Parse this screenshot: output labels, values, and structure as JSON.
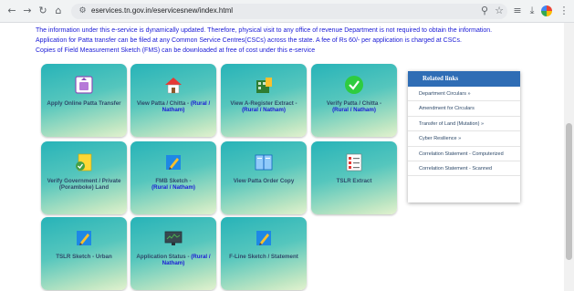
{
  "browser": {
    "url": "eservices.tn.gov.in/eservicesnew/index.html"
  },
  "info_lines": [
    "The information under this e-service is dynamically updated. Therefore, physical visit to any office of revenue Department is not required to obtain the information.",
    "Application for Patta transfer can be filed at any Common Service Centres(CSCs) across the state. A fee of Rs 60/- per application is charged at CSCs.",
    "Copies of Field Measurement Sketch (FMS) can be downloaded at free of cost under this e-service"
  ],
  "tiles": [
    {
      "label": "Apply Online Patta Transfer",
      "sub": "",
      "icon": "document-upload-icon"
    },
    {
      "label": "View Patta / Chitta -",
      "sub": "(Rural / Natham)",
      "icon": "house-icon"
    },
    {
      "label": "View A-Register Extract -",
      "sub": "(Rural / Natham)",
      "icon": "building-document-icon"
    },
    {
      "label": "Verify Patta / Chitta -",
      "sub": "(Rural / Natham)",
      "icon": "checkmark-icon"
    },
    {
      "label": "Verify Government / Private (Poramboke) Land",
      "sub": "",
      "icon": "document-check-icon"
    },
    {
      "label": "FMB Sketch -",
      "sub": "(Rural / Natham)",
      "icon": "pencil-sketch-icon"
    },
    {
      "label": "View Patta Order Copy",
      "sub": "",
      "icon": "book-icon"
    },
    {
      "label": "TSLR Extract",
      "sub": "",
      "icon": "form-list-icon"
    },
    {
      "label": "TSLR Sketch - Urban",
      "sub": "",
      "icon": "pencil-sketch-icon"
    },
    {
      "label": "Application Status -",
      "sub": "(Rural / Natham)",
      "icon": "monitor-icon"
    },
    {
      "label": "F-Line Sketch / Statement",
      "sub": "",
      "icon": "pencil-sketch-icon"
    }
  ],
  "related_links": {
    "title": "Related links",
    "items": [
      "Department Circulars »",
      "Amendment for Circulars",
      "Transfer of Land (Mutation) »",
      "Cyber Resilience »",
      "Correlation Statement - Computerized",
      "Correlation Statement - Scanned"
    ]
  },
  "colors": {
    "tile_top": "#27b3b8",
    "tile_bottom": "#e2f2cf",
    "link_blue": "#1a1ad6",
    "header_blue": "#2f6db5"
  }
}
